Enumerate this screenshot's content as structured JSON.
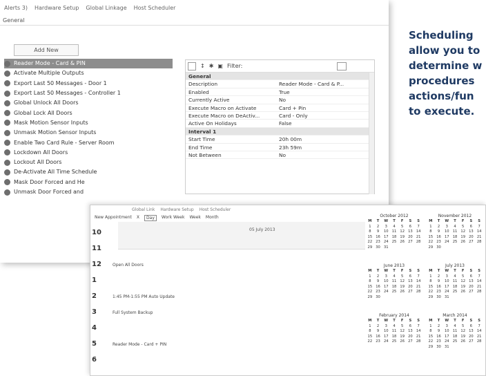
{
  "top_window": {
    "tabs": [
      "Alerts 3)",
      "Hardware Setup",
      "Global Linkage",
      "Host Scheduler"
    ],
    "subtab": "General",
    "add_new_label": "Add New",
    "macros": [
      "Reader Mode - Card & PIN",
      "Activate Multiple Outputs",
      "Export Last 50 Messages - Door 1",
      "Export Last 50 Messages - Controller 1",
      "Global Unlock All Doors",
      "Global Lock All Doors",
      "Mask Motion Sensor Inputs",
      "Unmask Motion Sensor Inputs",
      "Enable Two Card Rule - Server Room",
      "Lockdown All Doors",
      "Lockout All Doors",
      "De-Activate All Time Schedule",
      "Mask Door Forced and He",
      "Unmask Door Forced and"
    ],
    "properties": {
      "filter_label": "Filter:",
      "rows": [
        {
          "k": "General",
          "v": "",
          "cat": true
        },
        {
          "k": "Description",
          "v": "Reader Mode - Card & P..."
        },
        {
          "k": "Enabled",
          "v": "True"
        },
        {
          "k": "Currently Active",
          "v": "No"
        },
        {
          "k": "Execute Macro on Activate",
          "v": "Card + Pin"
        },
        {
          "k": "Execute Macro on DeActiv...",
          "v": "Card - Only"
        },
        {
          "k": "Active On Holidays",
          "v": "False"
        },
        {
          "k": "Interval 1",
          "v": "",
          "cat": true
        },
        {
          "k": "Start Time",
          "v": "20h 00m"
        },
        {
          "k": "End Time",
          "v": "23h 59m"
        },
        {
          "k": "Not Between",
          "v": "No"
        }
      ]
    }
  },
  "caption_lines": [
    "Scheduling",
    "allow you to",
    "determine w",
    "procedures",
    "actions/fun",
    "to execute."
  ],
  "bottom_window": {
    "tabs": [
      "Global Link",
      "Hardware Setup",
      "Host Scheduler"
    ],
    "toolbar": [
      "New Appointment",
      "X",
      "Day",
      "Work Week",
      "Week",
      "Month"
    ],
    "date": "05 July 2013",
    "hours": [
      {
        "h": "10",
        "ev": ""
      },
      {
        "h": "11",
        "ev": ""
      },
      {
        "h": "12",
        "ev": "Open All Doors"
      },
      {
        "h": "1",
        "ev": ""
      },
      {
        "h": "2",
        "ev": "1:45 PM-1:55 PM Auto Update"
      },
      {
        "h": "3",
        "ev": "Full System Backup"
      },
      {
        "h": "4",
        "ev": ""
      },
      {
        "h": "5",
        "ev": "Reader Mode - Card + PIN"
      },
      {
        "h": "6",
        "ev": ""
      }
    ],
    "calendars": [
      {
        "title": "October 2012",
        "days": "1 2 3 4 5 6 7 8 9 10 11 12 13 14 15 16 17 18 19 20 21 22 23 24 25 26 27 28 29 30 31"
      },
      {
        "title": "November 2012",
        "days": "1 2 3 4 5 6 7 8 9 10 11 12 13 14 15 16 17 18 19 20 21 22 23 24 25 26 27 28 29 30"
      },
      {
        "title": "June 2013",
        "days": "1 2 3 4 5 6 7 8 9 10 11 12 13 14 15 16 17 18 19 20 21 22 23 24 25 26 27 28 29 30"
      },
      {
        "title": "July 2013",
        "days": "1 2 3 4 5 6 7 8 9 10 11 12 13 14 15 16 17 18 19 20 21 22 23 24 25 26 27 28 29 30 31"
      },
      {
        "title": "February 2014",
        "days": "1 2 3 4 5 6 7 8 9 10 11 12 13 14 15 16 17 18 19 20 21 22 23 24 25 26 27 28"
      },
      {
        "title": "March 2014",
        "days": "1 2 3 4 5 6 7 8 9 10 11 12 13 14 15 16 17 18 19 20 21 22 23 24 25 26 27 28 29 30 31"
      }
    ],
    "weekday_header": [
      "M",
      "T",
      "W",
      "T",
      "F",
      "S",
      "S"
    ]
  }
}
